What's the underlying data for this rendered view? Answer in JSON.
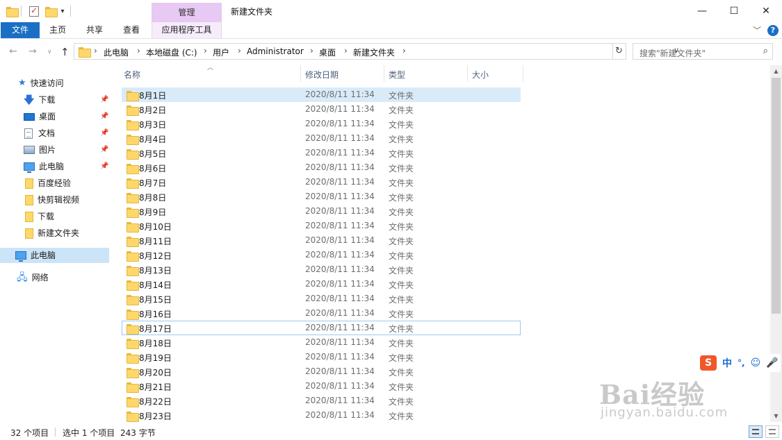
{
  "window": {
    "title": "新建文件夹",
    "context_tab_group": "管理",
    "caption_buttons": [
      "minimize",
      "maximize",
      "close"
    ]
  },
  "ribbon": {
    "tabs": [
      "文件",
      "主页",
      "共享",
      "查看",
      "应用程序工具"
    ],
    "active_tab": "文件"
  },
  "address": {
    "crumbs": [
      "此电脑",
      "本地磁盘 (C:)",
      "用户",
      "Administrator",
      "桌面",
      "新建文件夹"
    ]
  },
  "search": {
    "placeholder": "搜索\"新建文件夹\""
  },
  "nav": {
    "quick_access_label": "快速访问",
    "quick_items": [
      {
        "label": "下载",
        "icon": "download-arrow-icon",
        "pinned": true
      },
      {
        "label": "桌面",
        "icon": "desktop-icon",
        "pinned": true
      },
      {
        "label": "文档",
        "icon": "document-icon",
        "pinned": true
      },
      {
        "label": "图片",
        "icon": "pictures-icon",
        "pinned": true
      },
      {
        "label": "此电脑",
        "icon": "computer-icon",
        "pinned": true
      },
      {
        "label": "百度经验",
        "icon": "folder-icon",
        "pinned": false
      },
      {
        "label": "快剪辑视频",
        "icon": "folder-icon",
        "pinned": false
      },
      {
        "label": "下载",
        "icon": "folder-icon",
        "pinned": false
      },
      {
        "label": "新建文件夹",
        "icon": "folder-icon",
        "pinned": false
      }
    ],
    "this_pc_label": "此电脑",
    "network_label": "网络"
  },
  "columns": {
    "name": "名称",
    "date": "修改日期",
    "type": "类型",
    "size": "大小"
  },
  "files": [
    {
      "name": "8月1日",
      "date": "2020/8/11 11:34",
      "type": "文件夹"
    },
    {
      "name": "8月2日",
      "date": "2020/8/11 11:34",
      "type": "文件夹"
    },
    {
      "name": "8月3日",
      "date": "2020/8/11 11:34",
      "type": "文件夹"
    },
    {
      "name": "8月4日",
      "date": "2020/8/11 11:34",
      "type": "文件夹"
    },
    {
      "name": "8月5日",
      "date": "2020/8/11 11:34",
      "type": "文件夹"
    },
    {
      "name": "8月6日",
      "date": "2020/8/11 11:34",
      "type": "文件夹"
    },
    {
      "name": "8月7日",
      "date": "2020/8/11 11:34",
      "type": "文件夹"
    },
    {
      "name": "8月8日",
      "date": "2020/8/11 11:34",
      "type": "文件夹"
    },
    {
      "name": "8月9日",
      "date": "2020/8/11 11:34",
      "type": "文件夹"
    },
    {
      "name": "8月10日",
      "date": "2020/8/11 11:34",
      "type": "文件夹"
    },
    {
      "name": "8月11日",
      "date": "2020/8/11 11:34",
      "type": "文件夹"
    },
    {
      "name": "8月12日",
      "date": "2020/8/11 11:34",
      "type": "文件夹"
    },
    {
      "name": "8月13日",
      "date": "2020/8/11 11:34",
      "type": "文件夹"
    },
    {
      "name": "8月14日",
      "date": "2020/8/11 11:34",
      "type": "文件夹"
    },
    {
      "name": "8月15日",
      "date": "2020/8/11 11:34",
      "type": "文件夹"
    },
    {
      "name": "8月16日",
      "date": "2020/8/11 11:34",
      "type": "文件夹"
    },
    {
      "name": "8月17日",
      "date": "2020/8/11 11:34",
      "type": "文件夹"
    },
    {
      "name": "8月18日",
      "date": "2020/8/11 11:34",
      "type": "文件夹"
    },
    {
      "name": "8月19日",
      "date": "2020/8/11 11:34",
      "type": "文件夹"
    },
    {
      "name": "8月20日",
      "date": "2020/8/11 11:34",
      "type": "文件夹"
    },
    {
      "name": "8月21日",
      "date": "2020/8/11 11:34",
      "type": "文件夹"
    },
    {
      "name": "8月22日",
      "date": "2020/8/11 11:34",
      "type": "文件夹"
    },
    {
      "name": "8月23日",
      "date": "2020/8/11 11:34",
      "type": "文件夹"
    }
  ],
  "selected_file": "8月1日",
  "focused_file": "8月17日",
  "status": {
    "count": "32 个项目",
    "selection": "选中 1 个项目",
    "size": "243 字节"
  },
  "ime": {
    "logo": "S",
    "mode": "中",
    "punct": "°,"
  },
  "watermark": {
    "logo": "Bai经验",
    "url": "jingyan.baidu.com"
  },
  "colors": {
    "accent": "#1a6fc5",
    "selection": "#d9ebf9",
    "context_tab": "#e7c9f3"
  }
}
